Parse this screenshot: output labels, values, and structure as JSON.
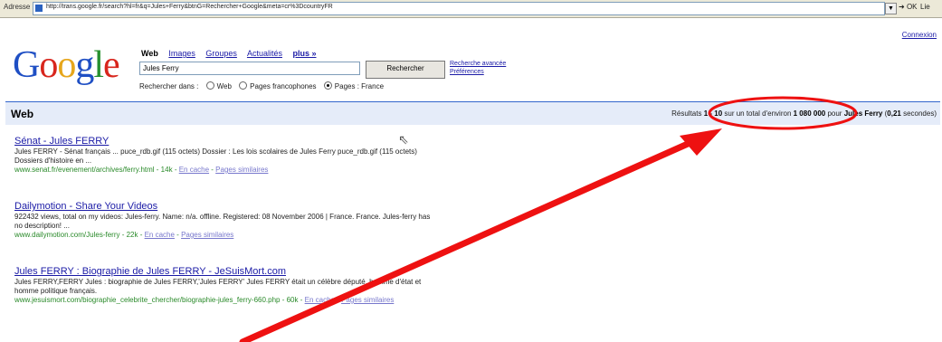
{
  "address_bar": {
    "label": "Adresse",
    "url": "http://trans.google.fr/search?hl=fr&q=Jules+Ferry&btnG=Rechercher+Google&meta=cr%3DcountryFR",
    "go_label": "OK",
    "links_label": "Lie"
  },
  "header": {
    "connexion_label": "Connexion",
    "logo": [
      {
        "ch": "G",
        "color": "#1f4fc4"
      },
      {
        "ch": "o",
        "color": "#d8261d"
      },
      {
        "ch": "o",
        "color": "#e6a61b"
      },
      {
        "ch": "g",
        "color": "#1f4fc4"
      },
      {
        "ch": "l",
        "color": "#26902f"
      },
      {
        "ch": "e",
        "color": "#d8261d"
      }
    ],
    "tabs": {
      "web": "Web",
      "images": "Images",
      "groupes": "Groupes",
      "actualites": "Actualités",
      "plus": "plus »"
    }
  },
  "search": {
    "query": "Jules Ferry",
    "button_label": "Rechercher",
    "advanced_label": "Recherche avancée",
    "preferences_label": "Préférences",
    "scope_prefix": "Rechercher dans :",
    "scope_options": [
      "Web",
      "Pages francophones",
      "Pages : France"
    ],
    "scope_selected": "Pages : France"
  },
  "results_bar": {
    "title": "Web",
    "stats_prefix": "Résultats ",
    "range": "1 - 10",
    "stats_mid": " sur un total d'environ ",
    "total": "1 080 000",
    "stats_for": " pour ",
    "query": "Jules Ferry",
    "time": "0,21",
    "time_unit": " secondes)"
  },
  "results": [
    {
      "title": "Sénat - Jules FERRY",
      "snippet": "Jules FERRY - Sénat français ... puce_rdb.gif (115 octets) Dossier : Les lois scolaires de Jules Ferry puce_rdb.gif (115 octets) Dossiers d'histoire en ...",
      "url": "www.senat.fr/evenement/archives/ferry.html - 14k",
      "cache": "En cache",
      "similar": "Pages similaires"
    },
    {
      "title": "Dailymotion - Share Your Videos",
      "snippet": "922432 views, total on my videos: Jules-ferry. Name: n/a. offline. Registered: 08 November 2006 | France. France. Jules-ferry has no description! ...",
      "url": "www.dailymotion.com/Jules-ferry - 22k",
      "cache": "En cache",
      "similar": "Pages similaires"
    },
    {
      "title": "Jules FERRY : Biographie de Jules FERRY - JeSuisMort.com",
      "snippet": "Jules FERRY,FERRY Jules : biographie de Jules FERRY,'Jules FERRY' Jules FERRY était un célèbre député, homme d'état et homme politique français.",
      "url": "www.jesuismort.com/biographie_celebrite_chercher/biographie-jules_ferry-660.php - 60k",
      "cache": "En cache",
      "similar": "Pages similaires"
    }
  ],
  "annotation": {
    "color": "#ee1111"
  }
}
